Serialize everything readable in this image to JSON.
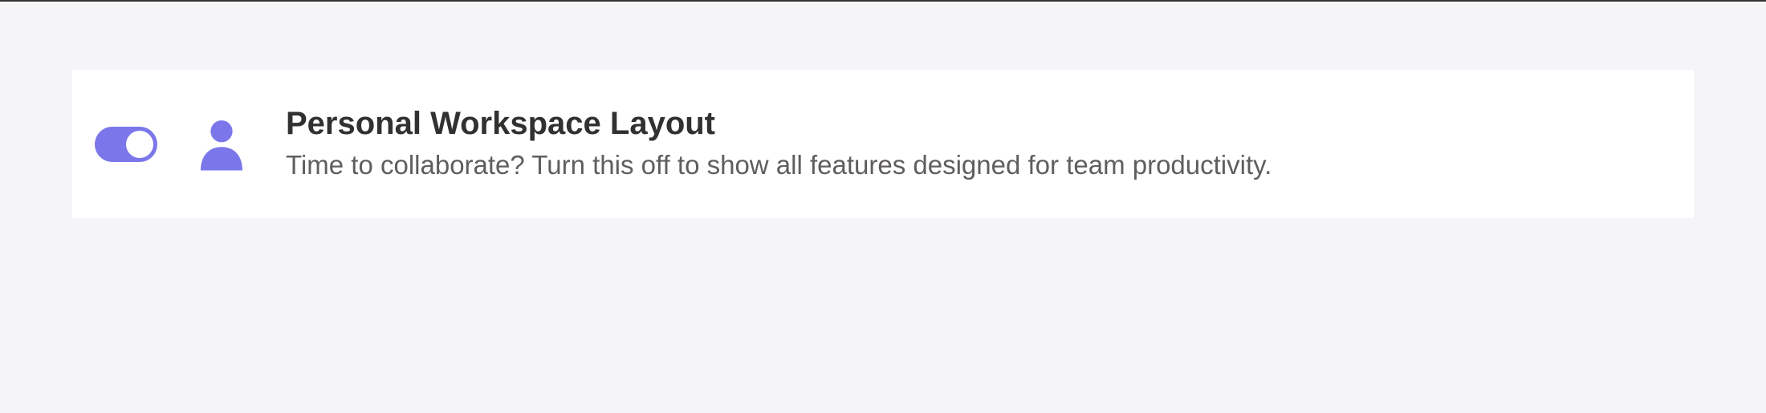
{
  "setting": {
    "title": "Personal Workspace Layout",
    "description": "Time to collaborate? Turn this off to show all features designed for team productivity.",
    "toggle_on": true
  },
  "colors": {
    "accent": "#7b77ea",
    "card_bg": "#ffffff",
    "page_bg": "#f5f5f7",
    "title_text": "#323130",
    "subtitle_text": "#605e5c"
  }
}
